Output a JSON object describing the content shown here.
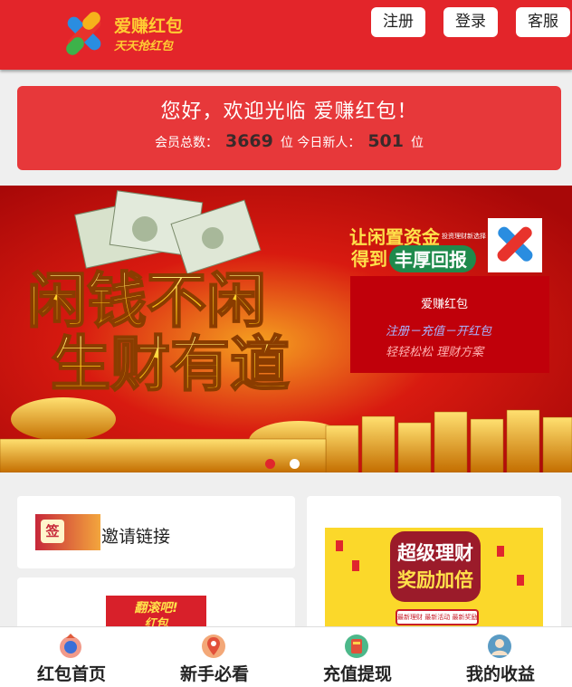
{
  "header": {
    "logo_line1": "爱赚红包",
    "logo_line2": "天天抢红包",
    "buttons": {
      "register": "注册",
      "login": "登录",
      "service": "客服"
    }
  },
  "welcome": {
    "title": "您好，欢迎光临 爱赚红包！",
    "members_label": "会员总数：",
    "members_count": "3669",
    "members_unit": "位",
    "new_label": "今日新人：",
    "new_count": "501",
    "new_unit": "位"
  },
  "banner": {
    "headline_line1": "闲钱不闲",
    "headline_line2": "生财有道",
    "slogan_prefix": "让闲置资金",
    "slogan_small": "投资理财新选择",
    "slogan_bottom_a": "得到",
    "slogan_bottom_b": "丰厚回报",
    "panel_title": "爱赚红包",
    "panel_line1": "注册－充值－开红包",
    "panel_line2": "轻轻松松  理财方案",
    "active_slide": 1,
    "slide_count": 2
  },
  "cards": {
    "invite_label": "邀请链接",
    "invite_badge": "签",
    "promo_line1": "超级理财",
    "promo_line2": "奖励加倍",
    "promo_bottom": "最新理财 最新活动 最新奖励",
    "hongbao_text1": "翻滚吧!",
    "hongbao_text2": "红包"
  },
  "nav": {
    "items": [
      {
        "label": "红包首页"
      },
      {
        "label": "新手必看"
      },
      {
        "label": "充值提现"
      },
      {
        "label": "我的收益"
      }
    ]
  },
  "colors": {
    "brand_red": "#e3252a",
    "welcome_red": "#e7383a",
    "gold": "#ffcc33"
  }
}
